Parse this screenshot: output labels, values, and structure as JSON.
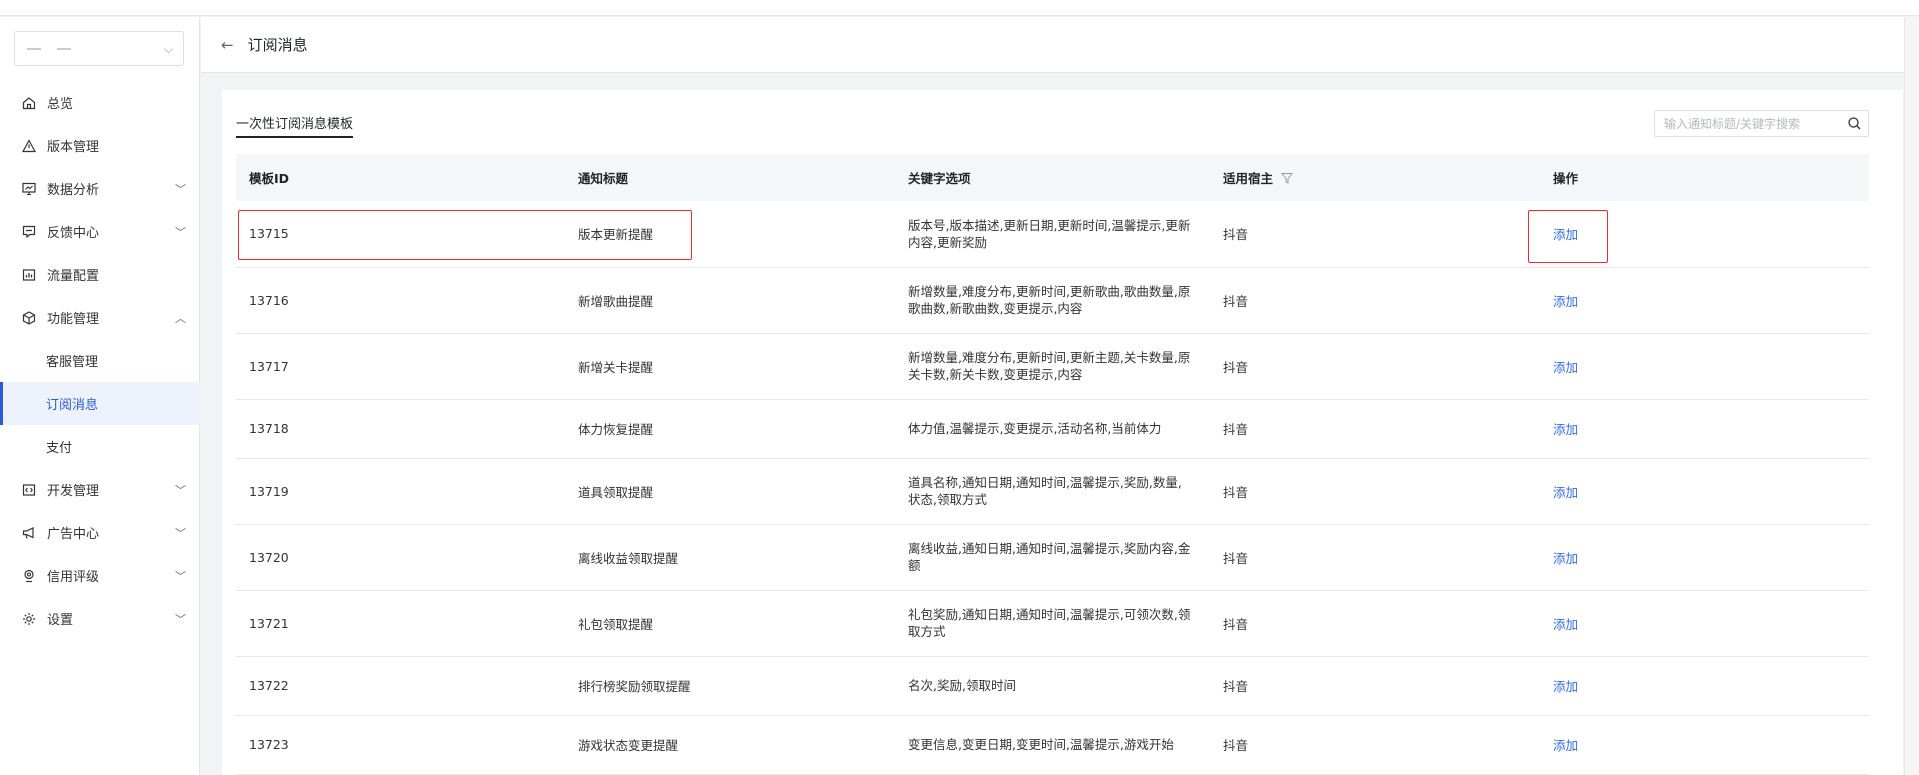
{
  "header": {
    "title": "订阅消息",
    "back_icon": "arrow-left-icon"
  },
  "sidebar": {
    "items": [
      {
        "label": "总览",
        "icon": "home-icon",
        "expandable": false
      },
      {
        "label": "版本管理",
        "icon": "warning-triangle-icon",
        "expandable": false
      },
      {
        "label": "数据分析",
        "icon": "monitor-chart-icon",
        "expandable": true,
        "expanded": false
      },
      {
        "label": "反馈中心",
        "icon": "feedback-icon",
        "expandable": true,
        "expanded": false
      },
      {
        "label": "流量配置",
        "icon": "bar-chart-icon",
        "expandable": false
      },
      {
        "label": "功能管理",
        "icon": "cube-icon",
        "expandable": true,
        "expanded": true,
        "children": [
          {
            "label": "客服管理"
          },
          {
            "label": "订阅消息",
            "active": true
          },
          {
            "label": "支付"
          }
        ]
      },
      {
        "label": "开发管理",
        "icon": "code-icon",
        "expandable": true,
        "expanded": false
      },
      {
        "label": "广告中心",
        "icon": "megaphone-icon",
        "expandable": true,
        "expanded": false
      },
      {
        "label": "信用评级",
        "icon": "location-pin-icon",
        "expandable": true,
        "expanded": false
      },
      {
        "label": "设置",
        "icon": "gear-icon",
        "expandable": true,
        "expanded": false
      }
    ]
  },
  "main": {
    "tab": "一次性订阅消息模板",
    "search": {
      "placeholder": "输入通知标题/关键字搜索"
    },
    "table": {
      "columns": [
        "模板ID",
        "通知标题",
        "关键字选项",
        "适用宿主",
        "操作"
      ],
      "rows": [
        {
          "id": "13715",
          "title": "版本更新提醒",
          "keywords": "版本号,版本描述,更新日期,更新时间,温馨提示,更新内容,更新奖励",
          "host": "抖音",
          "action": "添加"
        },
        {
          "id": "13716",
          "title": "新增歌曲提醒",
          "keywords": "新增数量,难度分布,更新时间,更新歌曲,歌曲数量,原歌曲数,新歌曲数,变更提示,内容",
          "host": "抖音",
          "action": "添加"
        },
        {
          "id": "13717",
          "title": "新增关卡提醒",
          "keywords": "新增数量,难度分布,更新时间,更新主题,关卡数量,原关卡数,新关卡数,变更提示,内容",
          "host": "抖音",
          "action": "添加"
        },
        {
          "id": "13718",
          "title": "体力恢复提醒",
          "keywords": "体力值,温馨提示,变更提示,活动名称,当前体力",
          "host": "抖音",
          "action": "添加"
        },
        {
          "id": "13719",
          "title": "道具领取提醒",
          "keywords": "道具名称,通知日期,通知时间,温馨提示,奖励,数量,状态,领取方式",
          "host": "抖音",
          "action": "添加"
        },
        {
          "id": "13720",
          "title": "离线收益领取提醒",
          "keywords": "离线收益,通知日期,通知时间,温馨提示,奖励内容,金额",
          "host": "抖音",
          "action": "添加"
        },
        {
          "id": "13721",
          "title": "礼包领取提醒",
          "keywords": "礼包奖励,通知日期,通知时间,温馨提示,可领次数,领取方式",
          "host": "抖音",
          "action": "添加"
        },
        {
          "id": "13722",
          "title": "排行榜奖励领取提醒",
          "keywords": "名次,奖励,领取时间",
          "host": "抖音",
          "action": "添加"
        },
        {
          "id": "13723",
          "title": "游戏状态变更提醒",
          "keywords": "变更信息,变更日期,变更时间,温馨提示,游戏开始",
          "host": "抖音",
          "action": "添加"
        }
      ]
    }
  },
  "colors": {
    "accent": "#2f6bec",
    "highlight_box": "#ee2a2a"
  }
}
